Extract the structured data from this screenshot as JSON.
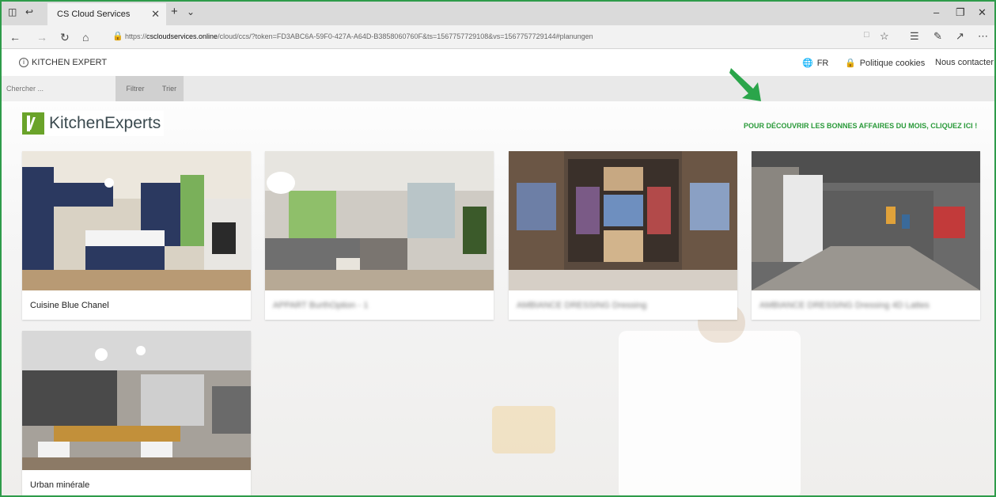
{
  "browser": {
    "tab_title": "CS Cloud Services",
    "url_prefix": "https://",
    "url_host": "cscloudservices.online",
    "url_path": "/cloud/ccs/?token=FD3ABC6A-59F0-427A-A64D-B3858060760F&ts=1567757729108&vs=1567757729144#planungen"
  },
  "header": {
    "brand": "KITCHEN EXPERT",
    "language": "FR",
    "cookies": "Politique cookies",
    "contact": "Nous contacter"
  },
  "toolbar": {
    "search_placeholder": "Chercher ...",
    "filter_label": "Filtrer",
    "sort_label": "Trier"
  },
  "logo": {
    "text": "KitchenExperts"
  },
  "promo": {
    "text": "POUR DÉCOUVRIR LES BONNES AFFAIRES DU MOIS, CLIQUEZ ICI !"
  },
  "projects": [
    {
      "title": "Cuisine Blue Chanel"
    },
    {
      "title": "APPART BurthOption - 1"
    },
    {
      "title": "AMBIANCE DRESSING Dressing"
    },
    {
      "title": "AMBIANCE DRESSING Dressing 4D Lattes"
    },
    {
      "title": "Urban minérale"
    }
  ],
  "colors": {
    "accent": "#2a9a3a",
    "frame": "#2e9b4a",
    "logo": "#6aa32a"
  }
}
